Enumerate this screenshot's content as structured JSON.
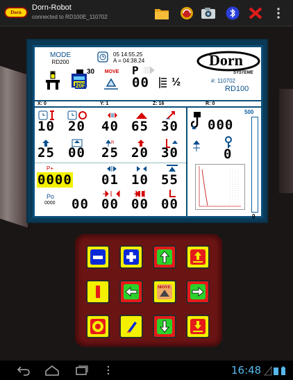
{
  "app": {
    "title": "Dorn-Robot",
    "subtitle": "connected to RD100E_110702",
    "logo_text": "Dorn",
    "action_icons": [
      "folder-icon",
      "sync-icon",
      "camera-icon",
      "bluetooth-icon",
      "close-icon",
      "overflow-menu-icon"
    ]
  },
  "display": {
    "mode_label": "MODE",
    "mode_value": "RD200",
    "time_line1": "05 14:55.25",
    "time_line2": "A = 04:38.24",
    "counter_value": "30",
    "counter_tag": "20F",
    "move_label": "MOVE",
    "program_letter": "P",
    "program_value": "00",
    "fraction": "½",
    "hash_value": "#: 110702",
    "model": "RD100",
    "brand": "Dorn",
    "brand_sub": "SYSTEME",
    "axes": {
      "x": "X: 0",
      "y": "Y: 1",
      "z": "Z: 16",
      "r": "R: 0"
    },
    "row1_values": [
      "10",
      "20",
      "40",
      "65",
      "30"
    ],
    "row2_values": [
      "25",
      "00",
      "25",
      "20",
      "30"
    ],
    "row3_label": "P+",
    "row3_values": [
      "0000",
      "01",
      "10",
      "55"
    ],
    "row4_label": "Po",
    "row4_sub": "0000",
    "row4_values": [
      "00",
      "00",
      "00",
      "00"
    ],
    "right_top_value": "000",
    "right_mid_value": "0",
    "gauge_max": "500",
    "gauge_min": "0",
    "gauge_level": 0.0
  },
  "keypad": {
    "keys": [
      "minus-key",
      "plus-key",
      "up-arrow-key",
      "lift-up-key",
      "stop-key",
      "left-arrow-key",
      "move-key",
      "right-arrow-key",
      "circle-key",
      "brush-key",
      "down-arrow-key",
      "lift-down-key"
    ],
    "move_label": "MOVE"
  },
  "statusbar": {
    "time": "16:48"
  },
  "colors": {
    "accent_blue": "#0a4f8c",
    "key_yellow": "#f3f000",
    "key_green": "#2bd12b",
    "key_red": "#e51b1b",
    "keypad_bg": "#6b1414"
  }
}
